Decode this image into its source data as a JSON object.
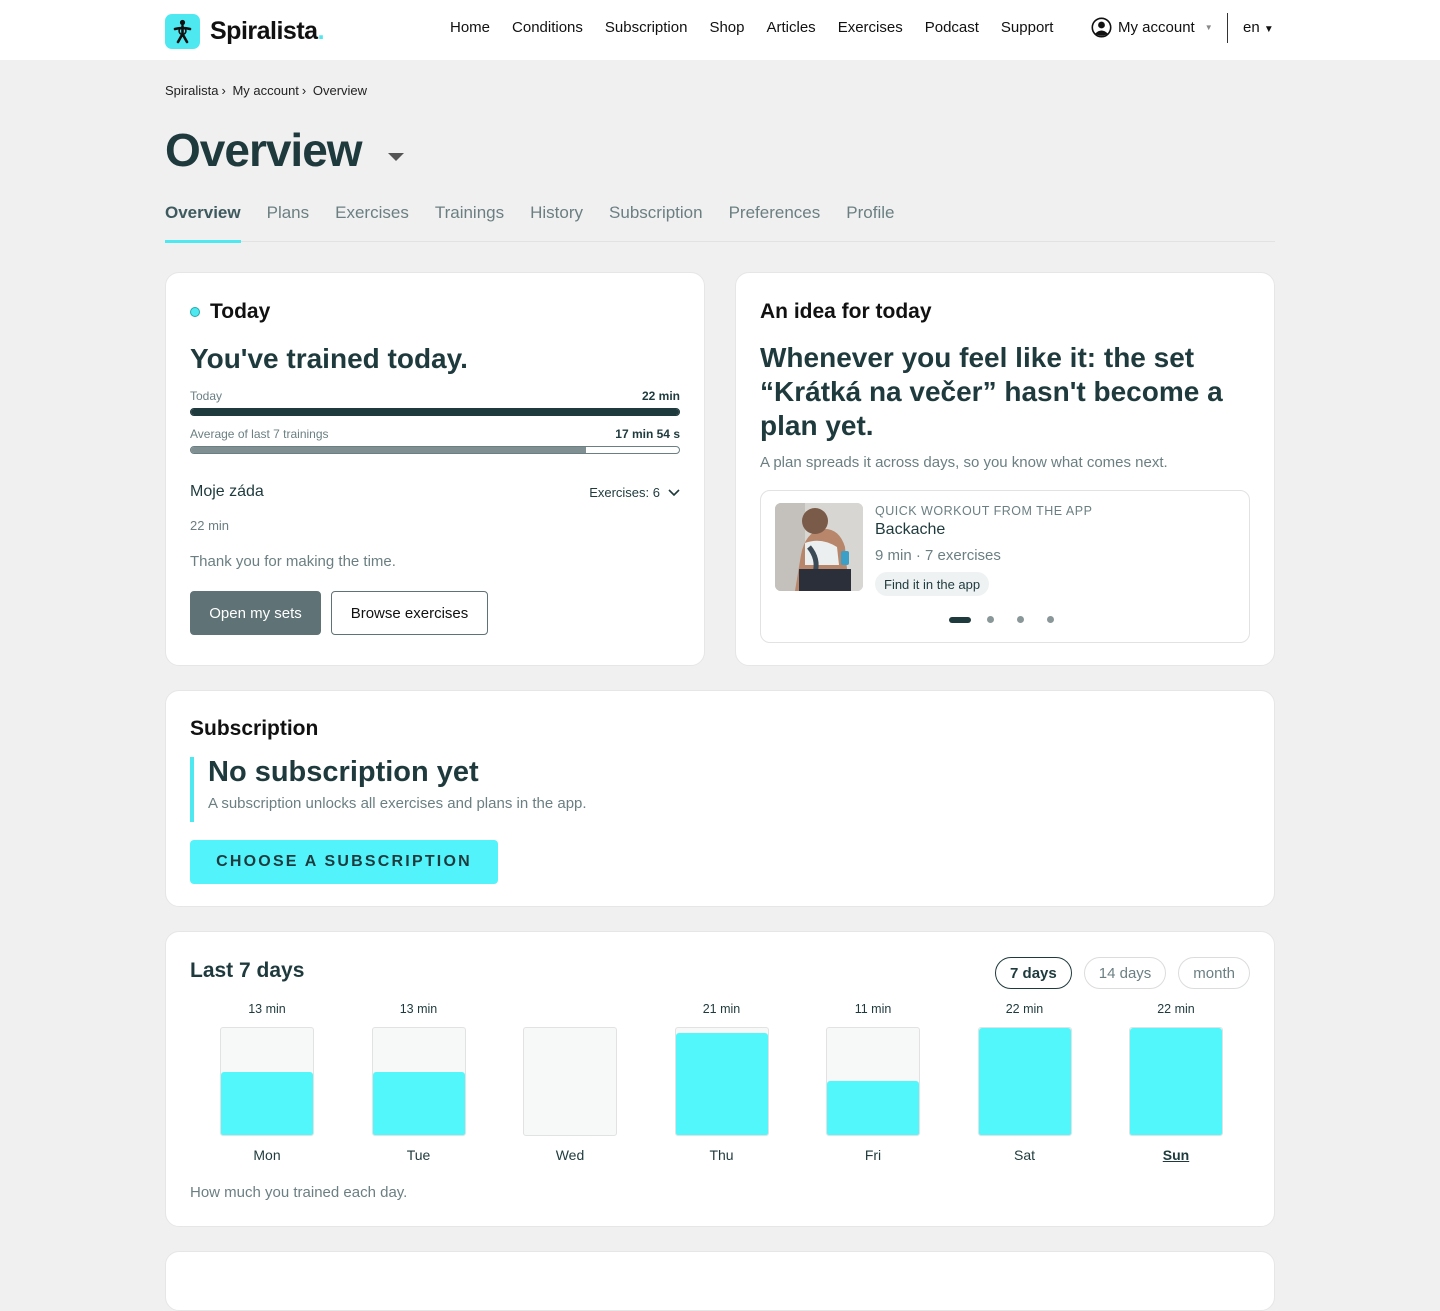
{
  "brand": {
    "name": "Spiralista",
    "accent": "#4ee8f0",
    "dark": "#1f3a3d"
  },
  "nav": [
    "Home",
    "Conditions",
    "Subscription",
    "Shop",
    "Articles",
    "Exercises",
    "Podcast",
    "Support"
  ],
  "account": {
    "label": "My account",
    "icon": "user-circle-icon"
  },
  "language": "en",
  "breadcrumb": [
    "Spiralista",
    "My account",
    "Overview"
  ],
  "page_title": "Overview",
  "tabs": [
    "Overview",
    "Plans",
    "Exercises",
    "Trainings",
    "History",
    "Subscription",
    "Preferences",
    "Profile"
  ],
  "active_tab": "Overview",
  "today": {
    "heading": "Today",
    "title": "You've trained today.",
    "today_label": "Today",
    "today_value": "22 min",
    "today_progress": 1.0,
    "avg_label": "Average of last 7 trainings",
    "avg_value": "17 min 54 s",
    "avg_progress": 0.81,
    "set_name": "Moje záda",
    "exercises_label": "Exercises: 6",
    "set_duration": "22 min",
    "thanks": "Thank you for making the time.",
    "open_sets": "Open my sets",
    "browse": "Browse exercises"
  },
  "idea": {
    "heading": "An idea for today",
    "title": "Whenever you feel like it: the set “Krátká na večer” hasn't become a plan yet.",
    "subtitle": "A plan spreads it across days, so you know what comes next.",
    "workout": {
      "kicker": "QUICK WORKOUT FROM THE APP",
      "name": "Backache",
      "meta": "9 min · 7 exercises",
      "chip": "Find it in the app"
    },
    "carousel_active": 0,
    "carousel_count": 4
  },
  "subscription": {
    "heading": "Subscription",
    "title": "No subscription yet",
    "text": "A subscription unlocks all exercises and plans in the app.",
    "cta": "CHOOSE A SUBSCRIPTION"
  },
  "last_days": {
    "heading": "Last 7 days",
    "ranges": [
      "7 days",
      "14 days",
      "month"
    ],
    "active_range": "7 days",
    "caption": "How much you trained each day."
  },
  "chart_data": {
    "type": "bar",
    "categories": [
      "Mon",
      "Tue",
      "Wed",
      "Thu",
      "Fri",
      "Sat",
      "Sun"
    ],
    "values": [
      13,
      13,
      0,
      21,
      11,
      22,
      22
    ],
    "value_labels": [
      "13 min",
      "13 min",
      "",
      "21 min",
      "11 min",
      "22 min",
      "22 min"
    ],
    "ylim": [
      0,
      22
    ],
    "highlight": "Sun",
    "bar_color": "#52f7fb"
  }
}
